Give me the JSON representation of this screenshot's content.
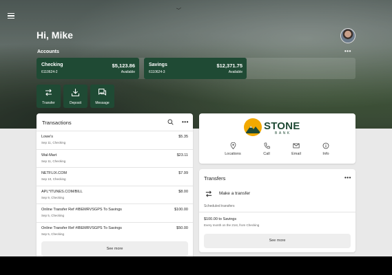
{
  "header": {
    "greeting": "Hi, Mike",
    "accounts_label": "Accounts",
    "more": "•••"
  },
  "accounts": [
    {
      "name": "Checking",
      "number": "6110624-2",
      "balance": "$5,123.86",
      "avail": "Available"
    },
    {
      "name": "Savings",
      "number": "6110624-3",
      "balance": "$12,371.75",
      "avail": "Available"
    }
  ],
  "actions": [
    {
      "label": "Transfer",
      "icon": "transfer-icon"
    },
    {
      "label": "Deposit",
      "icon": "deposit-icon"
    },
    {
      "label": "Message",
      "icon": "message-icon"
    }
  ],
  "transactions": {
    "title": "Transactions",
    "more": "•••",
    "rows": [
      {
        "desc": "Lowe's",
        "meta": "Sep 11, Checking",
        "amount": "$5.35"
      },
      {
        "desc": "Wal-Mart",
        "meta": "Sep 11, Checking",
        "amount": "$23.11"
      },
      {
        "desc": "NETFLIX.COM",
        "meta": "Sep 10, Checking",
        "amount": "$7.99"
      },
      {
        "desc": "APL*ITUNES.COM/BILL",
        "meta": "Sep 9, Checking",
        "amount": "$8.00"
      },
      {
        "desc": "Online Transfer Ref #IBEMRVSGPS To Savings",
        "meta": "Sep 5, Checking",
        "amount": "$100.00"
      },
      {
        "desc": "Online Transfer Ref #IBEMRVSGPS To Savings",
        "meta": "Sep 5, Checking",
        "amount": "$50.00"
      }
    ],
    "see_more": "See more"
  },
  "bank": {
    "logo_stone": "STONE",
    "logo_bank": "BANK",
    "quick_links": [
      {
        "label": "Locations",
        "icon": "location-pin-icon"
      },
      {
        "label": "Call",
        "icon": "phone-icon"
      },
      {
        "label": "Email",
        "icon": "email-icon"
      },
      {
        "label": "Info",
        "icon": "info-icon"
      }
    ]
  },
  "transfers": {
    "title": "Transfers",
    "more": "•••",
    "make_transfer": "Make a transfer",
    "scheduled_label": "Scheduled transfers",
    "scheduled_amount": "$100.00 to Savings",
    "scheduled_meta": "Every month on the 21st, from Checking",
    "see_more": "See more"
  },
  "colors": {
    "brand_green": "#1f4a34",
    "logo_gold": "#f2a900"
  }
}
